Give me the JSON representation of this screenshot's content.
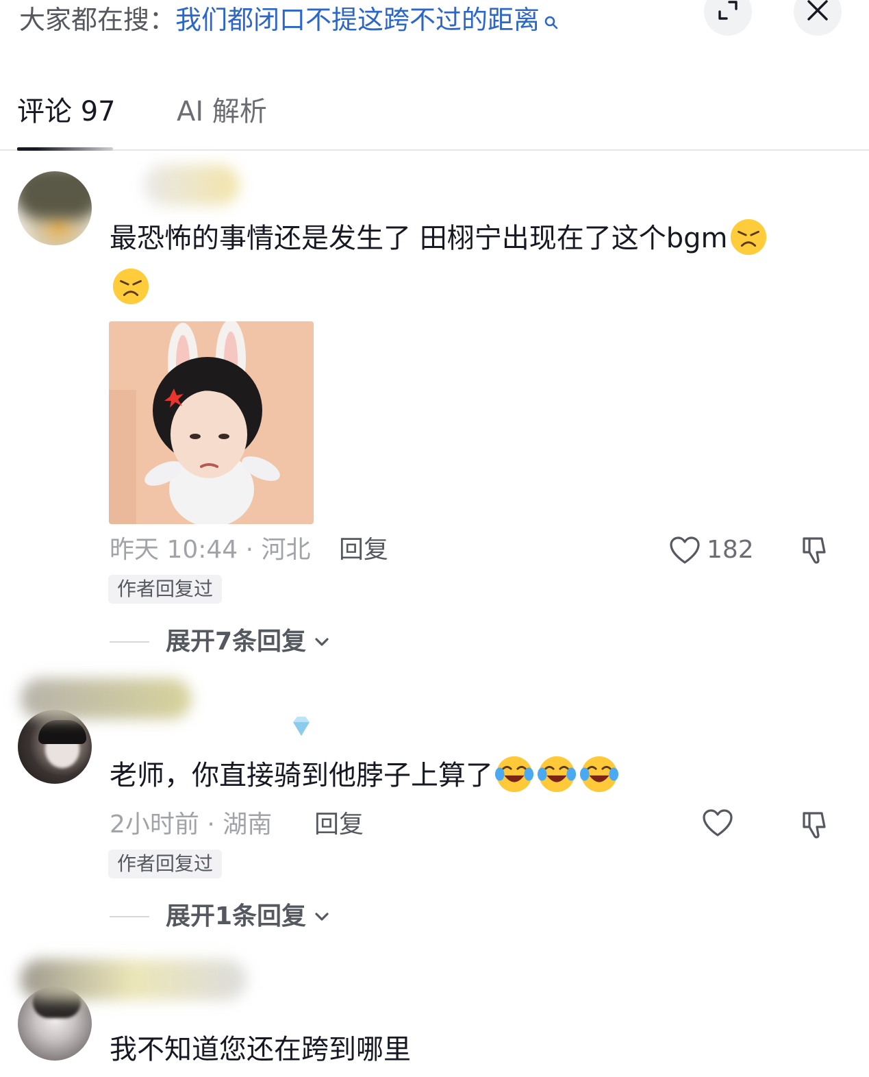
{
  "search": {
    "prefix": "大家都在搜：",
    "query": "我们都闭口不提这跨不过的距离"
  },
  "tabs": {
    "comments_label": "评论 97",
    "ai_label": "AI 解析"
  },
  "comments": [
    {
      "text": "最恐怖的事情还是发生了 田栩宁出现在了这个bgm",
      "emojis": [
        "angry-face-icon",
        "angry-face-icon"
      ],
      "meta": "昨天 10:44 · 河北",
      "reply_label": "回复",
      "likes": "182",
      "badge": "作者回复过",
      "expand_label": "展开7条回复"
    },
    {
      "text": "老师，你直接骑到他脖子上算了",
      "emojis": [
        "laughing-crying-face-icon",
        "laughing-crying-face-icon",
        "laughing-crying-face-icon"
      ],
      "meta": "2小时前 · 湖南",
      "reply_label": "回复",
      "badge": "作者回复过",
      "expand_label": "展开1条回复"
    },
    {
      "text": "我不知道您还在跨到哪里"
    }
  ],
  "colors": {
    "search_query": "#2b66c8",
    "text_primary": "#161823",
    "text_secondary": "#a1a3a8"
  }
}
